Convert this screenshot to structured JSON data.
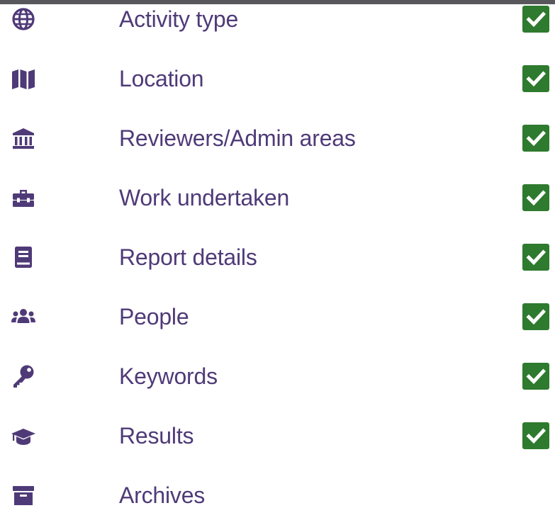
{
  "colors": {
    "accent": "#4f3a78",
    "check_green": "#2e7a2e",
    "top_bar": "#58585c"
  },
  "steps": [
    {
      "label": "Activity type",
      "icon": "globe-icon",
      "completed": true
    },
    {
      "label": "Location",
      "icon": "map-icon",
      "completed": true
    },
    {
      "label": "Reviewers/Admin areas",
      "icon": "landmark-icon",
      "completed": true
    },
    {
      "label": "Work undertaken",
      "icon": "toolbox-icon",
      "completed": true
    },
    {
      "label": "Report details",
      "icon": "book-icon",
      "completed": true
    },
    {
      "label": "People",
      "icon": "users-icon",
      "completed": true
    },
    {
      "label": "Keywords",
      "icon": "key-icon",
      "completed": true
    },
    {
      "label": "Results",
      "icon": "graduation-cap-icon",
      "completed": true
    },
    {
      "label": "Archives",
      "icon": "archive-icon",
      "completed": false
    }
  ]
}
